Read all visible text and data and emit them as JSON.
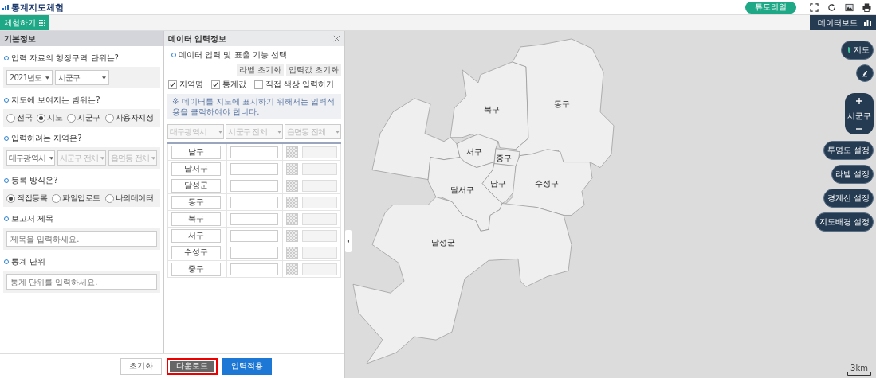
{
  "app": {
    "title": "통계지도체험",
    "tutorial": "튜토리얼"
  },
  "toolbar": {
    "tab": "체험하기",
    "dashboard": "데이터보드"
  },
  "basic_info": {
    "title": "기본정보",
    "sections": [
      {
        "kind": "select",
        "question": "입력 자료의 행정구역 단위는?",
        "selects": [
          {
            "value": "2021년도",
            "disabled": false
          },
          {
            "value": "시군구",
            "disabled": false
          }
        ]
      },
      {
        "kind": "radio",
        "question": "지도에 보여지는 범위는?",
        "options": [
          {
            "label": "전국",
            "selected": false
          },
          {
            "label": "시도",
            "selected": true
          },
          {
            "label": "시군구",
            "selected": false
          },
          {
            "label": "사용자지정",
            "selected": false
          }
        ]
      },
      {
        "kind": "select",
        "question": "입력하려는 지역은?",
        "selects": [
          {
            "value": "대구광역시",
            "disabled": false
          },
          {
            "value": "시군구 전체",
            "disabled": true
          },
          {
            "value": "읍면동 전체",
            "disabled": true
          }
        ]
      },
      {
        "kind": "radio",
        "question": "등록 방식은?",
        "options": [
          {
            "label": "직접등록",
            "selected": true
          },
          {
            "label": "파일업로드",
            "selected": false
          },
          {
            "label": "나의데이터",
            "selected": false
          }
        ]
      },
      {
        "kind": "input",
        "question": "보고서 제목",
        "placeholder": "제목을 입력하세요."
      },
      {
        "kind": "input",
        "question": "통계 단위",
        "placeholder": "통계 단위를 입력하세요."
      }
    ]
  },
  "data_panel": {
    "title": "데이터 입력정보",
    "heading": "데이터 입력 및 표출 기능 선택",
    "buttons": [
      "라벨 초기화",
      "입력값 초기화"
    ],
    "checkboxes": [
      {
        "label": "지역명",
        "checked": true
      },
      {
        "label": "통계값",
        "checked": true
      },
      {
        "label": "직접 색상 입력하기",
        "checked": false
      }
    ],
    "notice": "※ 데이터를 지도에 표시하기 위해서는 입력적용을 클릭하여야 합니다.",
    "selects": [
      {
        "value": "대구광역시",
        "disabled": true
      },
      {
        "value": "시군구 전체",
        "disabled": true
      },
      {
        "value": "읍면동 전체",
        "disabled": true
      }
    ],
    "rows": [
      {
        "region": "남구"
      },
      {
        "region": "달서구"
      },
      {
        "region": "달성군"
      },
      {
        "region": "동구"
      },
      {
        "region": "북구"
      },
      {
        "region": "서구"
      },
      {
        "region": "수성구"
      },
      {
        "region": "중구"
      }
    ]
  },
  "footer": [
    {
      "label": "초기화",
      "kind": "plain",
      "highlighted": false
    },
    {
      "label": "다운로드",
      "kind": "dark",
      "highlighted": true
    },
    {
      "label": "입력적용",
      "kind": "primary",
      "highlighted": false
    }
  ],
  "map": {
    "regions": [
      {
        "name": "북구"
      },
      {
        "name": "동구"
      },
      {
        "name": "서구"
      },
      {
        "name": "중구"
      },
      {
        "name": "남구"
      },
      {
        "name": "수성구"
      },
      {
        "name": "달서구"
      },
      {
        "name": "달성군"
      }
    ],
    "controls": [
      {
        "kind": "map",
        "label": "지도"
      },
      {
        "kind": "pen"
      },
      {
        "kind": "zoom",
        "label": "시군구"
      },
      {
        "kind": "text",
        "label": "투명도 설정"
      },
      {
        "kind": "text",
        "label": "라벨 설정"
      },
      {
        "kind": "text",
        "label": "경계선 설정"
      },
      {
        "kind": "text",
        "label": "지도배경 설정"
      }
    ],
    "scale": "3km"
  }
}
